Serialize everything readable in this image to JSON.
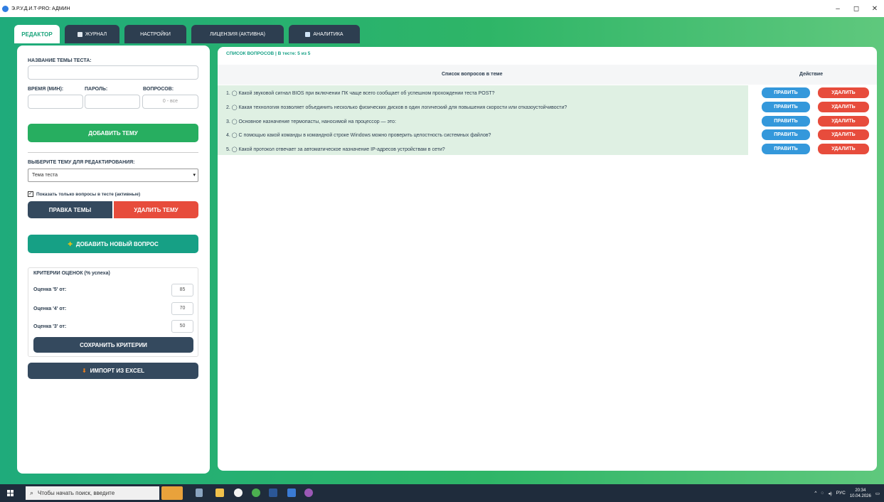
{
  "window": {
    "title": "Э.Р.У.Д.И.Т-PRO: АДМИН",
    "controls": [
      "–",
      "◻",
      "✕"
    ]
  },
  "tabs": [
    {
      "label": "РЕДАКТОР",
      "active": true
    },
    {
      "label": "ЖУРНАЛ",
      "icon": "journal-icon"
    },
    {
      "label": "НАСТРОЙКИ"
    },
    {
      "label": "ЛИЦЕНЗИЯ (АКТИВНА)"
    },
    {
      "label": "АНАЛИТИКА",
      "icon": "chart-icon"
    }
  ],
  "editor": {
    "topic_name_label": "НАЗВАНИЕ ТЕМЫ ТЕСТА:",
    "topic_name_value": "",
    "time_label": "ВРЕМЯ (МИН):",
    "password_label": "ПАРОЛЬ:",
    "questions_label": "ВОПРОСОВ:",
    "questions_placeholder": "0 - все",
    "add_topic_button": "ДОБАВИТЬ ТЕМУ",
    "select_topic_label": "ВЫБЕРИТЕ ТЕМУ ДЛЯ РЕДАКТИРОВАНИЯ:",
    "selected_topic": "Тема теста",
    "show_active_checkbox": "Показать только вопросы в тесте (активные)",
    "show_active_checked": true,
    "edit_topic_button": "ПРАВКА ТЕМЫ",
    "delete_topic_button": "УДАЛИТЬ ТЕМУ",
    "add_question_button": "ДОБАВИТЬ НОВЫЙ ВОПРОС",
    "criteria": {
      "title": "КРИТЕРИИ ОЦЕНОК (% успеха)",
      "rows": [
        {
          "label": "Оценка '5' от:",
          "value": "85"
        },
        {
          "label": "Оценка '4' от:",
          "value": "70"
        },
        {
          "label": "Оценка '3' от:",
          "value": "50"
        }
      ],
      "save_button": "СОХРАНИТЬ КРИТЕРИИ"
    },
    "import_button": "ИМПОРТ ИЗ EXCEL"
  },
  "questions": {
    "header": "СПИСОК ВОПРОСОВ | В тесте: 5 из 5",
    "col_list": "Список вопросов в теме",
    "col_action": "Действие",
    "edit_label": "ПРАВИТЬ",
    "delete_label": "УДАЛИТЬ",
    "items": [
      "1. ◯ Какой звуковой сигнал BIOS при включении ПК чаще всего сообщает об успешном прохождении теста POST?",
      "2. ◯ Какая технология позволяет объединить несколько физических дисков в один логический для повышения скорости или отказоустойчивости?",
      "3. ◯ Основное назначение термопасты, наносимой на процессор — это:",
      "4. ◯ С помощью какой команды в командной строке Windows можно проверить целостность системных файлов?",
      "5. ◯ Какой протокол отвечает за автоматическое назначение IP-адресов устройствам в сети?"
    ]
  },
  "taskbar": {
    "search_placeholder": "Чтобы начать поиск, введите",
    "language": "РУС",
    "time": "20:34",
    "date": "10.04.2026"
  },
  "colors": {
    "accent_green": "#27ae60",
    "dark": "#34495e",
    "red": "#e74c3c",
    "blue": "#3498db",
    "teal": "#16a085"
  }
}
